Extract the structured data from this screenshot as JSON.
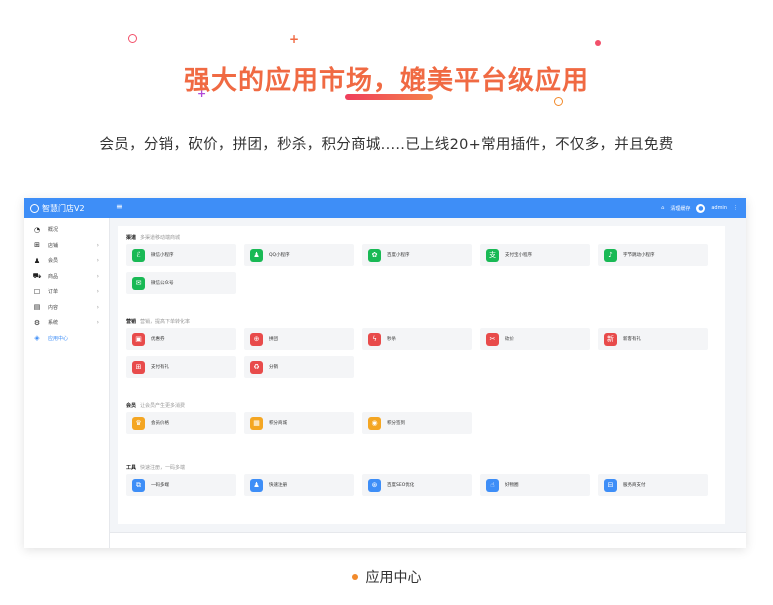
{
  "promo": {
    "headline": "强大的应用市场，媲美平台级应用",
    "subtitle": "会员，分销，砍价，拼团，秒杀，积分商城.....已上线20+常用插件，不仅多，并且免费",
    "caption": "应用中心"
  },
  "app": {
    "brand": "智慧门店V2",
    "menu_icon": "≡",
    "top_right": {
      "link": "清理缓存",
      "user": "admin"
    },
    "sidebar": [
      {
        "label": "概况",
        "icon": "dashboard-icon",
        "glyph": "◔",
        "has_children": false
      },
      {
        "label": "店铺",
        "icon": "grid-icon",
        "glyph": "⊞",
        "has_children": true
      },
      {
        "label": "会员",
        "icon": "users-icon",
        "glyph": "♟",
        "has_children": true
      },
      {
        "label": "商品",
        "icon": "cart-icon",
        "glyph": "⛟",
        "has_children": true
      },
      {
        "label": "订单",
        "icon": "order-icon",
        "glyph": "☐",
        "has_children": true
      },
      {
        "label": "内容",
        "icon": "content-icon",
        "glyph": "▤",
        "has_children": true
      },
      {
        "label": "系统",
        "icon": "gear-icon",
        "glyph": "⚙",
        "has_children": true
      },
      {
        "label": "应用中心",
        "icon": "apps-icon",
        "glyph": "◈",
        "has_children": false,
        "active": true
      }
    ],
    "sections": [
      {
        "title": "渠道",
        "desc": "多渠道移动端商城",
        "items": [
          {
            "label": "微信小程序",
            "color": "#19b955",
            "glyph": "ℰ"
          },
          {
            "label": "QQ小程序",
            "color": "#19b955",
            "glyph": "♟"
          },
          {
            "label": "百度小程序",
            "color": "#19b955",
            "glyph": "✿"
          },
          {
            "label": "支付宝小程序",
            "color": "#19b955",
            "glyph": "支"
          },
          {
            "label": "字节跳动小程序",
            "color": "#19b955",
            "glyph": "♪"
          },
          {
            "label": "微信公众号",
            "color": "#19b955",
            "glyph": "✉"
          }
        ]
      },
      {
        "title": "营销",
        "desc": "营销，提高下单转化率",
        "items": [
          {
            "label": "优惠券",
            "color": "#e84b4b",
            "glyph": "▣"
          },
          {
            "label": "拼团",
            "color": "#e84b4b",
            "glyph": "⊕"
          },
          {
            "label": "秒杀",
            "color": "#e84b4b",
            "glyph": "ϟ"
          },
          {
            "label": "砍价",
            "color": "#e84b4b",
            "glyph": "✂"
          },
          {
            "label": "新客有礼",
            "color": "#e84b4b",
            "glyph": "新"
          },
          {
            "label": "支付有礼",
            "color": "#e84b4b",
            "glyph": "⊞"
          },
          {
            "label": "分销",
            "color": "#e84b4b",
            "glyph": "♻"
          }
        ]
      },
      {
        "title": "会员",
        "desc": "让会员产生更多消费",
        "items": [
          {
            "label": "会员价格",
            "color": "#f4a623",
            "glyph": "♛"
          },
          {
            "label": "积分商城",
            "color": "#f4a623",
            "glyph": "▦"
          },
          {
            "label": "积分签到",
            "color": "#f4a623",
            "glyph": "◉"
          }
        ]
      },
      {
        "title": "工具",
        "desc": "快速注册，一码多端",
        "items": [
          {
            "label": "一码多端",
            "color": "#3e8ef7",
            "glyph": "⧉"
          },
          {
            "label": "快速注册",
            "color": "#3e8ef7",
            "glyph": "♟"
          },
          {
            "label": "百度SEO优化",
            "color": "#3e8ef7",
            "glyph": "⊛"
          },
          {
            "label": "好物圈",
            "color": "#3e8ef7",
            "glyph": "☝"
          },
          {
            "label": "服务商支付",
            "color": "#3e8ef7",
            "glyph": "⊟"
          }
        ]
      }
    ]
  }
}
